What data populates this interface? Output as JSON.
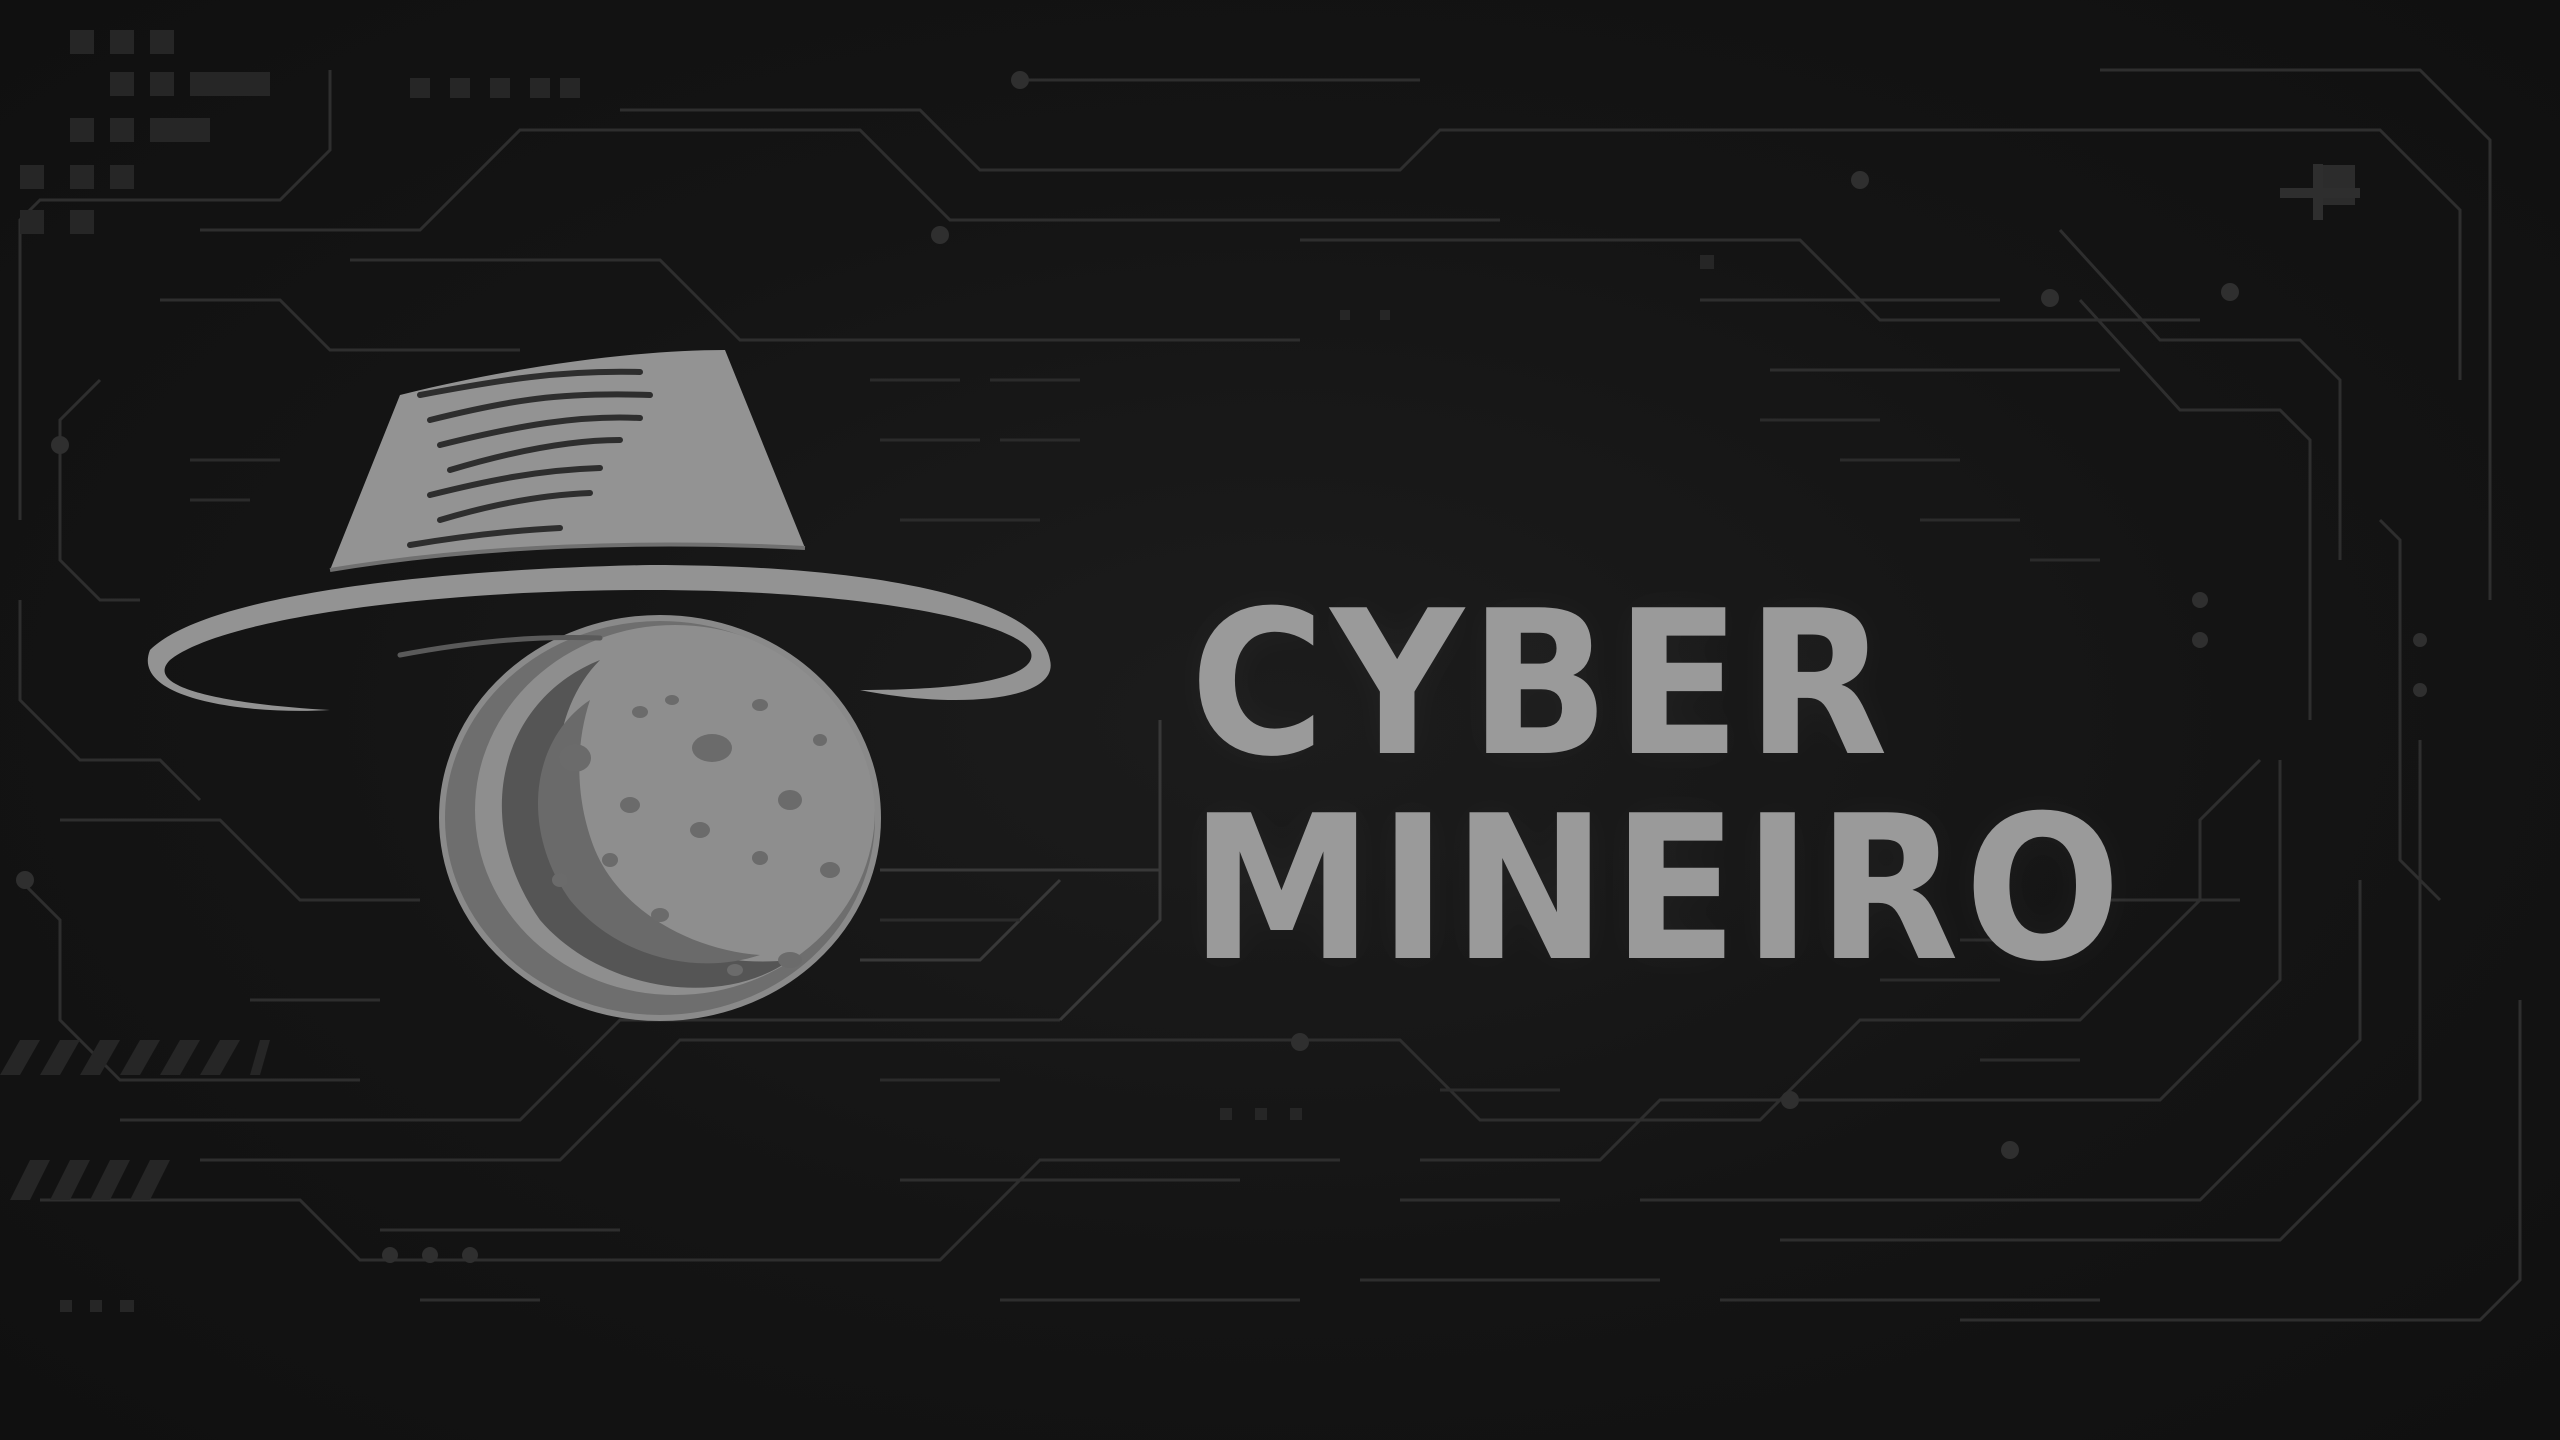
{
  "brand": {
    "line1": "CYBER",
    "line2": "MINEIRO"
  },
  "emblem": {
    "icon": "cowboy-hat-over-cheese-ball-icon"
  },
  "colors": {
    "background": "#121212",
    "circuit": "#2e2e2e",
    "circuit_light": "#383838",
    "logo": "#9a9a9a",
    "logo_shadow": "#5e5e5e"
  }
}
